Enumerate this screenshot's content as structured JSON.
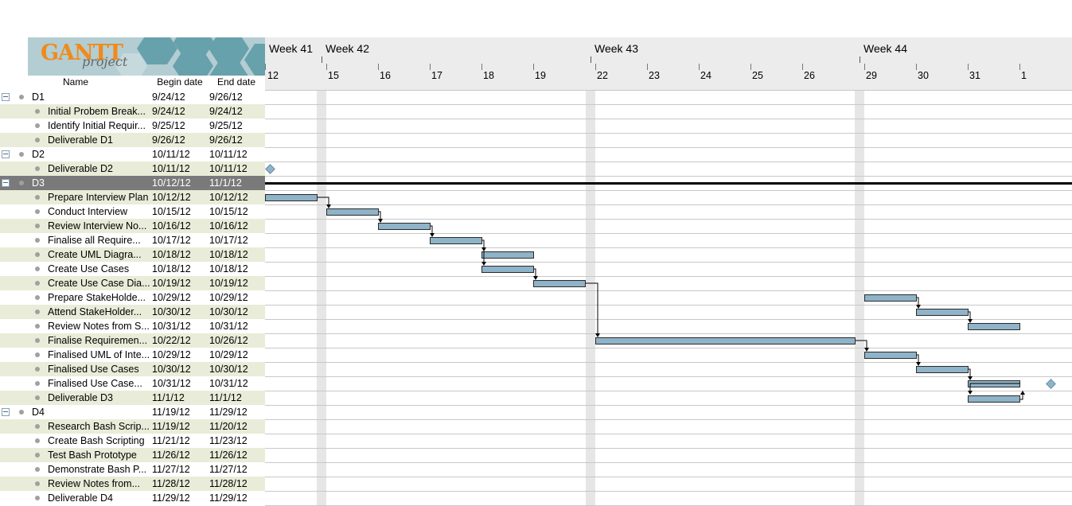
{
  "logo": {
    "word": "GANTT",
    "sub": "project"
  },
  "columns": {
    "name": "Name",
    "begin": "Begin date",
    "end": "End date"
  },
  "weeks": [
    "Week 41",
    "Week 42",
    "Week 43",
    "Week 44"
  ],
  "days": [
    "12",
    "15",
    "16",
    "17",
    "18",
    "19",
    "22",
    "23",
    "24",
    "25",
    "26",
    "29",
    "30",
    "31",
    "1"
  ],
  "colors": {
    "bar": "#8fb3c8",
    "selected_row": "#7a7a7a",
    "alt_row": "#e9ecd8",
    "logo_text": "#f08a1a"
  },
  "tasks": [
    {
      "name": "D1",
      "begin": "9/24/12",
      "end": "9/26/12"
    },
    {
      "name": "Initial Probem Break...",
      "begin": "9/24/12",
      "end": "9/24/12"
    },
    {
      "name": "Identify Initial Requir...",
      "begin": "9/25/12",
      "end": "9/25/12"
    },
    {
      "name": "Deliverable D1",
      "begin": "9/26/12",
      "end": "9/26/12"
    },
    {
      "name": "D2",
      "begin": "10/11/12",
      "end": "10/11/12"
    },
    {
      "name": "Deliverable D2",
      "begin": "10/11/12",
      "end": "10/11/12"
    },
    {
      "name": "D3",
      "begin": "10/12/12",
      "end": "11/1/12"
    },
    {
      "name": "Prepare Interview Plan",
      "begin": "10/12/12",
      "end": "10/12/12"
    },
    {
      "name": "Conduct Interview",
      "begin": "10/15/12",
      "end": "10/15/12"
    },
    {
      "name": "Review Interview No...",
      "begin": "10/16/12",
      "end": "10/16/12"
    },
    {
      "name": "Finalise all Require...",
      "begin": "10/17/12",
      "end": "10/17/12"
    },
    {
      "name": "Create UML Diagra...",
      "begin": "10/18/12",
      "end": "10/18/12"
    },
    {
      "name": "Create Use Cases",
      "begin": "10/18/12",
      "end": "10/18/12"
    },
    {
      "name": "Create Use Case Dia...",
      "begin": "10/19/12",
      "end": "10/19/12"
    },
    {
      "name": "Prepare StakeHolde...",
      "begin": "10/29/12",
      "end": "10/29/12"
    },
    {
      "name": "Attend StakeHolder...",
      "begin": "10/30/12",
      "end": "10/30/12"
    },
    {
      "name": "Review Notes from S...",
      "begin": "10/31/12",
      "end": "10/31/12"
    },
    {
      "name": "Finalise Requiremen...",
      "begin": "10/22/12",
      "end": "10/26/12"
    },
    {
      "name": "Finalised UML of Inte...",
      "begin": "10/29/12",
      "end": "10/29/12"
    },
    {
      "name": "Finalised Use Cases",
      "begin": "10/30/12",
      "end": "10/30/12"
    },
    {
      "name": "Finalised Use Case...",
      "begin": "10/31/12",
      "end": "10/31/12"
    },
    {
      "name": "Deliverable D3",
      "begin": "11/1/12",
      "end": "11/1/12"
    },
    {
      "name": "D4",
      "begin": "11/19/12",
      "end": "11/29/12"
    },
    {
      "name": "Research Bash Scrip...",
      "begin": "11/19/12",
      "end": "11/20/12"
    },
    {
      "name": "Create Bash Scripting",
      "begin": "11/21/12",
      "end": "11/23/12"
    },
    {
      "name": "Test Bash Prototype",
      "begin": "11/26/12",
      "end": "11/26/12"
    },
    {
      "name": "Demonstrate Bash P...",
      "begin": "11/27/12",
      "end": "11/27/12"
    },
    {
      "name": "Review Notes from...",
      "begin": "11/28/12",
      "end": "11/28/12"
    },
    {
      "name": "Deliverable D4",
      "begin": "11/29/12",
      "end": "11/29/12"
    }
  ]
}
